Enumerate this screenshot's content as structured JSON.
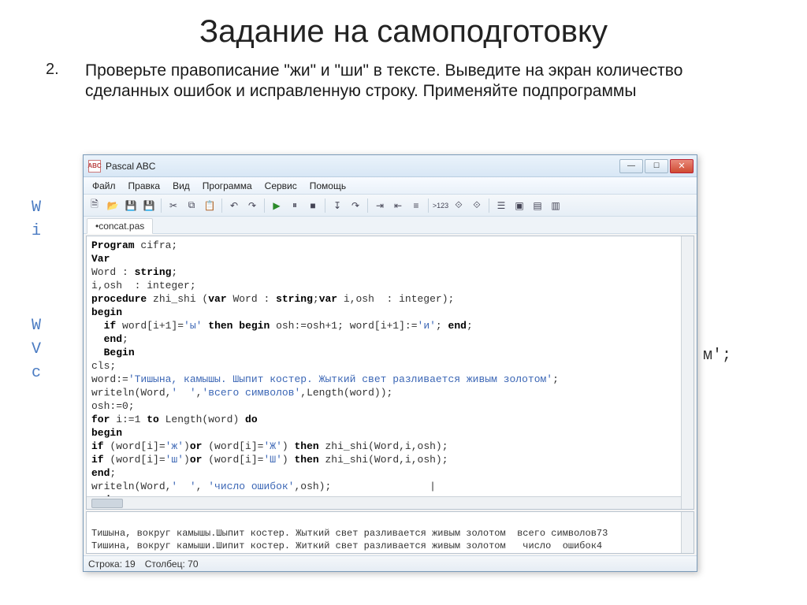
{
  "slide": {
    "title": "Задание на самоподготовку",
    "task_num": "2.",
    "task_text": "Проверьте правописание \"жи\" и \"ши\" в тексте. Выведите на экран количество сделанных ошибок и исправленную строку. Применяйте подпрограммы"
  },
  "hidden": {
    "l1": "W",
    "l2": "i",
    "l3": " ",
    "l4": " ",
    "l5": " ",
    "l6": "W",
    "l7": "V",
    "l8": "c",
    "l9": " ",
    "l10": " ",
    "l11": " ",
    "l12_suffix": "м';"
  },
  "window": {
    "title": "Pascal ABC",
    "icon_text": "ABC",
    "menu": [
      "Файл",
      "Правка",
      "Вид",
      "Программа",
      "Сервис",
      "Помощь"
    ],
    "toolbar_icons": [
      "file-new",
      "file-open",
      "save",
      "save-all",
      "sep",
      "cut",
      "copy",
      "paste",
      "sep",
      "undo",
      "redo",
      "sep",
      "run",
      "pause",
      "stop",
      "sep",
      "step-into",
      "step-over",
      "sep",
      "comment",
      "uncomment",
      "sep",
      "tpl1",
      "tpl2",
      "sep",
      "find",
      "help",
      "sep",
      "nav1",
      "nav2",
      "nav3",
      "nav4"
    ],
    "tab": "•concat.pas",
    "status": {
      "line_label": "Строка:",
      "line": "19",
      "col_label": "Столбец:",
      "col": "70"
    }
  },
  "code": {
    "lines": [
      {
        "t": [
          [
            "kw",
            "Program"
          ],
          [
            "",
            " cifra;"
          ]
        ]
      },
      {
        "t": [
          [
            "kw",
            "Var"
          ]
        ]
      },
      {
        "t": [
          [
            "",
            "Word : "
          ],
          [
            "typ",
            "string"
          ],
          [
            "",
            ";"
          ]
        ]
      },
      {
        "t": [
          [
            "",
            "i,osh  : integer;"
          ]
        ]
      },
      {
        "t": [
          [
            "kw",
            "procedure"
          ],
          [
            "",
            " zhi_shi ("
          ],
          [
            "kw",
            "var"
          ],
          [
            "",
            " Word : "
          ],
          [
            "typ",
            "string"
          ],
          [
            "",
            ";"
          ],
          [
            "kw",
            "var"
          ],
          [
            "",
            " i,osh  : integer);"
          ]
        ]
      },
      {
        "t": [
          [
            "kw",
            "begin"
          ]
        ]
      },
      {
        "t": [
          [
            "",
            "  "
          ],
          [
            "kw",
            "if"
          ],
          [
            "",
            " word[i+1]="
          ],
          [
            "str",
            "'ы'"
          ],
          [
            "",
            " "
          ],
          [
            "kw",
            "then begin"
          ],
          [
            "",
            " osh:=osh+1; word[i+1]:="
          ],
          [
            "str",
            "'и'"
          ],
          [
            "",
            "; "
          ],
          [
            "kw",
            "end"
          ],
          [
            "",
            ";"
          ]
        ]
      },
      {
        "t": [
          [
            "",
            "  "
          ],
          [
            "kw",
            "end"
          ],
          [
            "",
            ";"
          ]
        ]
      },
      {
        "t": [
          [
            "",
            "  "
          ],
          [
            "kw",
            "Begin"
          ]
        ]
      },
      {
        "t": [
          [
            "",
            "cls;"
          ]
        ]
      },
      {
        "t": [
          [
            "",
            "word:="
          ],
          [
            "str",
            "'Тишына, камышы. Шыпит костер. Жыткий свет разливается живым золотом'"
          ],
          [
            "",
            ";"
          ]
        ]
      },
      {
        "t": [
          [
            "",
            "writeln(Word,"
          ],
          [
            "str",
            "'  '"
          ],
          [
            "",
            ","
          ],
          [
            "str",
            "'всего символов'"
          ],
          [
            "",
            ",Length(word));"
          ]
        ]
      },
      {
        "t": [
          [
            "",
            "osh:=0;"
          ]
        ]
      },
      {
        "t": [
          [
            "kw",
            "for"
          ],
          [
            "",
            " i:=1 "
          ],
          [
            "kw",
            "to"
          ],
          [
            "",
            " Length(word) "
          ],
          [
            "kw",
            "do"
          ]
        ]
      },
      {
        "t": [
          [
            "kw",
            "begin"
          ]
        ]
      },
      {
        "t": [
          [
            "kw",
            "if"
          ],
          [
            "",
            " (word[i]="
          ],
          [
            "str",
            "'ж'"
          ],
          [
            "",
            ")"
          ],
          [
            "kw",
            "or"
          ],
          [
            "",
            " (word[i]="
          ],
          [
            "str",
            "'Ж'"
          ],
          [
            "",
            ") "
          ],
          [
            "kw",
            "then"
          ],
          [
            "",
            " zhi_shi(Word,i,osh);"
          ]
        ]
      },
      {
        "t": [
          [
            "kw",
            "if"
          ],
          [
            "",
            " (word[i]="
          ],
          [
            "str",
            "'ш'"
          ],
          [
            "",
            ")"
          ],
          [
            "kw",
            "or"
          ],
          [
            "",
            " (word[i]="
          ],
          [
            "str",
            "'Ш'"
          ],
          [
            "",
            ") "
          ],
          [
            "kw",
            "then"
          ],
          [
            "",
            " zhi_shi(Word,i,osh);"
          ]
        ]
      },
      {
        "t": [
          [
            "kw",
            "end"
          ],
          [
            "",
            ";"
          ]
        ]
      },
      {
        "t": [
          [
            "",
            "writeln(Word,"
          ],
          [
            "str",
            "'  '"
          ],
          [
            "",
            ", "
          ],
          [
            "str",
            "'число ошибок'"
          ],
          [
            "",
            ",osh);                |"
          ]
        ]
      },
      {
        "t": [
          [
            "kw",
            "end"
          ],
          [
            "",
            "."
          ]
        ]
      }
    ]
  },
  "output": {
    "line1": "Тишына, вокруг камышы.Шыпит костер. Жыткий свет разливается живым золотом  всего символов73",
    "line2": "Тишина, вокруг камыши.Шипит костер. Житкий свет разливается живым золотом   число  ошибок4"
  },
  "chart_data": null
}
